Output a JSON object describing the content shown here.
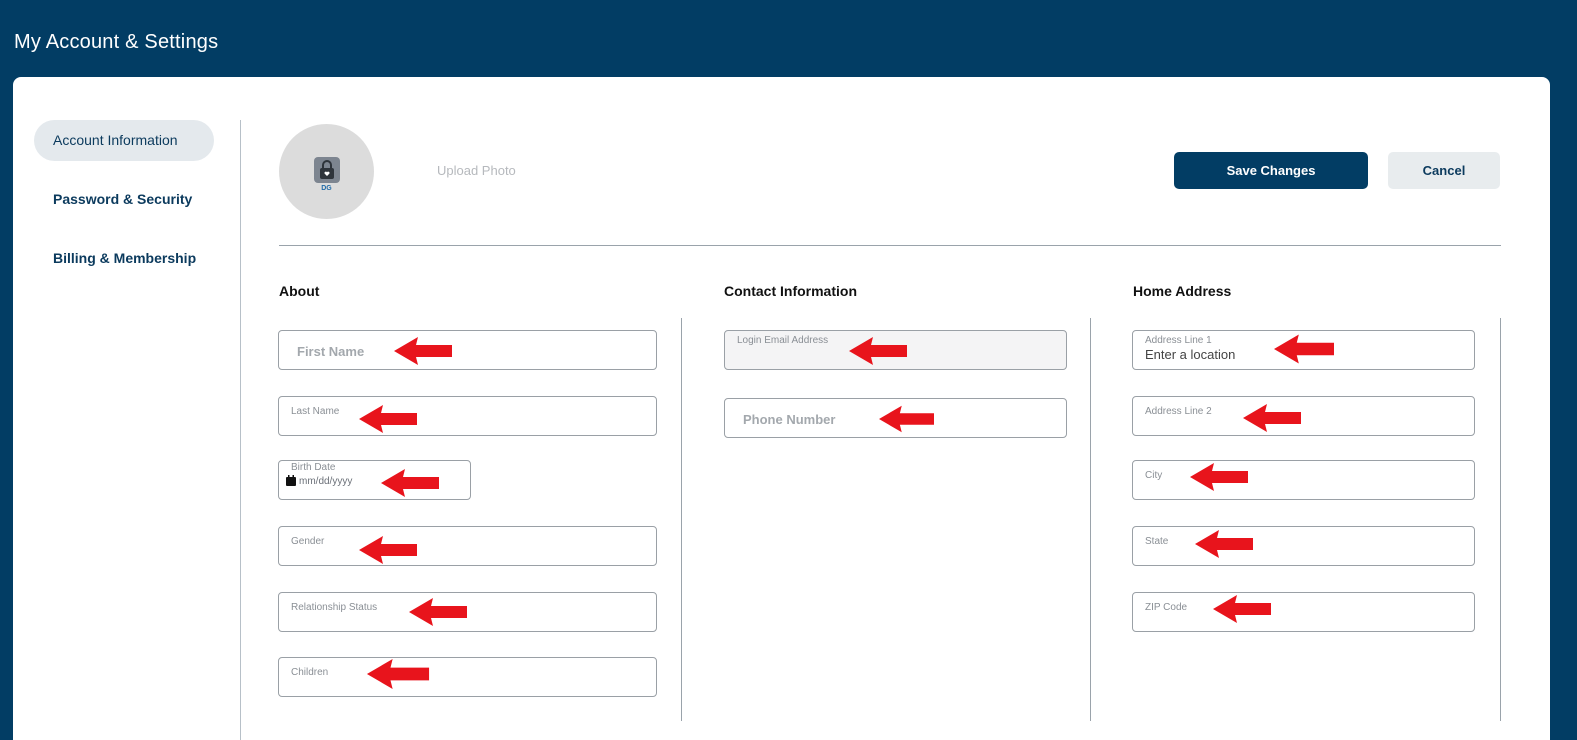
{
  "header": {
    "title": "My Account & Settings"
  },
  "sidebar": {
    "items": [
      {
        "label": "Account Information",
        "active": true
      },
      {
        "label": "Password & Security",
        "active": false
      },
      {
        "label": "Billing & Membership",
        "active": false
      }
    ]
  },
  "profile": {
    "avatar_initials": "DG",
    "avatar_icon": "lock-icon",
    "upload_label": "Upload Photo"
  },
  "actions": {
    "save_label": "Save Changes",
    "cancel_label": "Cancel"
  },
  "sections": {
    "about": {
      "title": "About",
      "first_name_placeholder": "First Name",
      "last_name_label": "Last Name",
      "birth_date_label": "Birth Date",
      "birth_date_placeholder": "mm/dd/yyyy",
      "gender_label": "Gender",
      "relationship_label": "Relationship Status",
      "children_label": "Children"
    },
    "contact": {
      "title": "Contact Information",
      "login_email_label": "Login Email Address",
      "phone_placeholder": "Phone Number"
    },
    "address": {
      "title": "Home Address",
      "line1_label": "Address Line 1",
      "line1_value": "Enter a location",
      "line2_label": "Address Line 2",
      "city_label": "City",
      "state_label": "State",
      "zip_label": "ZIP Code"
    }
  },
  "annotation_color": "#e8141c",
  "colors": {
    "brand": "#023d64",
    "active_nav_bg": "#e4e9ed"
  }
}
